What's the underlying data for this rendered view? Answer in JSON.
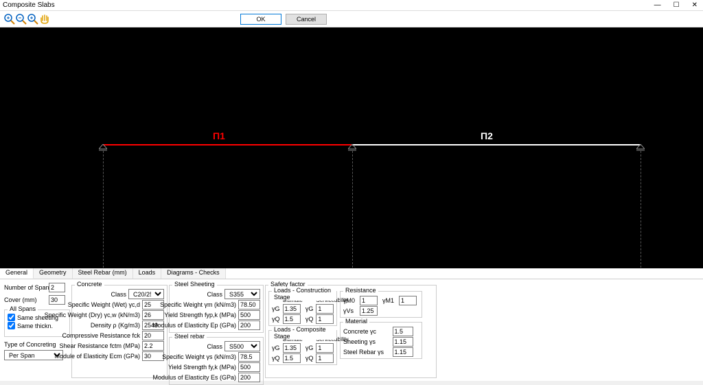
{
  "window": {
    "title": "Composite Slabs",
    "min": "—",
    "max": "☐",
    "close": "✕"
  },
  "buttons": {
    "ok": "OK",
    "cancel": "Cancel"
  },
  "viewport": {
    "span1": "Π1",
    "span2": "Π2"
  },
  "tabs": [
    "General",
    "Geometry",
    "Steel Rebar (mm)",
    "Loads",
    "Diagrams - Checks"
  ],
  "general": {
    "num_spans_label": "Number of Spans",
    "num_spans": "2",
    "cover_label": "Cover (mm)",
    "cover": "30",
    "all_spans": {
      "legend": "All Spans",
      "same_sheeting": "Same sheeting",
      "same_thickn": "Same thickn."
    },
    "type_concreting_label": "Type of Concreting",
    "type_concreting": "Per Span"
  },
  "concrete": {
    "legend": "Concrete",
    "class_label": "Class",
    "class": "C20/25",
    "sw_wet_label": "Specific Weight (Wet) γc,d",
    "sw_wet": "25",
    "sw_dry_label": "Specific Weight (Dry) γc,w (kN/m3)",
    "sw_dry": "26",
    "density_label": "Density ρ (Kg/m3)",
    "density": "2549",
    "fck_label": "Compressive Resistance fck",
    "fck": "20",
    "fctm_label": "Shear Resistance fctm (MPa)",
    "fctm": "2.2",
    "ecm_label": "Module of Elasticity Ecm (GPa)",
    "ecm": "30"
  },
  "sheeting": {
    "legend": "Steel Sheeting",
    "class_label": "Class",
    "class": "S355",
    "sw_label": "Specific Weight γm (kN/m3)",
    "sw": "78.50",
    "fypk_label": "Yield Strength fyp,k (MPa)",
    "fypk": "500",
    "ep_label": "Modulus of Elasticity Ep (GPa)",
    "ep": "200"
  },
  "rebar": {
    "legend": "Steel rebar",
    "class_label": "Class",
    "class": "S500",
    "sw_label": "Specific Weight γs (kN/m3)",
    "sw": "78.5",
    "fyk_label": "Yield Strength fy,k (MPa)",
    "fyk": "500",
    "es_label": "Modulus of Elasticity Es (GPa)",
    "es": "200"
  },
  "safety": {
    "legend": "Safety factor",
    "construction_legend": "Loads - Construction Stage",
    "composite_legend": "Loads - Composite Stage",
    "ultimate": "Ultimate",
    "service": "Serviceability",
    "gG": "γG",
    "gQ": "γQ",
    "u_gG_c": "1.35",
    "s_gG_c": "1",
    "u_gQ_c": "1.5",
    "s_gQ_c": "1",
    "u_gG_p": "1.35",
    "s_gG_p": "1",
    "u_gQ_p": "1.5",
    "s_gQ_p": "1",
    "resistance_legend": "Resistance",
    "gM0": "γΜ0",
    "gM0_v": "1",
    "gM1": "γΜ1",
    "gM1_v": "1",
    "gVs": "γVs",
    "gVs_v": "1.25",
    "material_legend": "Material",
    "concrete_gc": "Concrete γc",
    "concrete_gc_v": "1.5",
    "sheeting_gs": "Sheeting γs",
    "sheeting_gs_v": "1.15",
    "rebar_gs": "Steel Rebar  γs",
    "rebar_gs_v": "1.15"
  }
}
